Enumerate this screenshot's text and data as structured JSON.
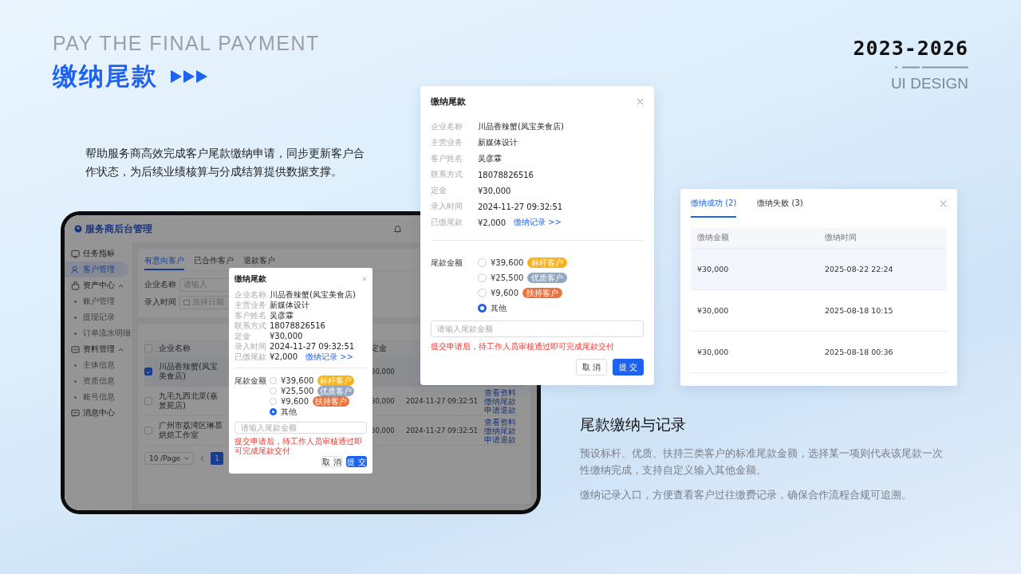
{
  "header": {
    "subtitle": "PAY THE FINAL PAYMENT",
    "title": "缴纳尾款",
    "years": "2023-2026",
    "tag": "UI DESIGN"
  },
  "intro": "帮助服务商高效完成客户尾款缴纳申请，同步更新客户合作状态，为后续业绩核算与分成结算提供数据支撑。",
  "tablet": {
    "brand": "服务商后台管理",
    "sidebar": [
      {
        "label": "任务指标",
        "selected": false
      },
      {
        "label": "客户管理",
        "selected": true
      },
      {
        "label": "资产中心",
        "selected": false,
        "expanded": true,
        "children": [
          {
            "label": "账户管理"
          },
          {
            "label": "提现记录"
          },
          {
            "label": "订单流水明细"
          }
        ]
      },
      {
        "label": "资料管理",
        "selected": false,
        "expanded": true,
        "children": [
          {
            "label": "主体信息"
          },
          {
            "label": "资质信息"
          },
          {
            "label": "账号信息"
          }
        ]
      },
      {
        "label": "消息中心",
        "selected": false
      }
    ],
    "tabs": [
      {
        "label": "有意向客户",
        "selected": true
      },
      {
        "label": "已合作客户",
        "selected": false
      },
      {
        "label": "退款客户",
        "selected": false
      }
    ],
    "filters": [
      {
        "label": "企业名称",
        "placeholder": "请输入",
        "kind": "text"
      },
      {
        "label": "录入时间",
        "placeholder": "选择日期",
        "kind": "date"
      }
    ],
    "table": {
      "all_checked": false,
      "columns": [
        "企业名称",
        "定金"
      ],
      "rows": [
        {
          "checked": true,
          "company": "川品香辣蟹(凤宝美食店)",
          "deposit": "30,000"
        },
        {
          "checked": false,
          "company": "九毛九西北菜(嘉景苑店)",
          "deposit": "30,000",
          "time": "2024-11-27 09:32:51",
          "actions": [
            "查看资料",
            "缴纳尾款",
            "申请退款"
          ]
        },
        {
          "checked": false,
          "company": "广州市荔湾区琳慕烘焙工作室",
          "deposit": "30,000",
          "time": "2024-11-27 09:32:51",
          "actions": [
            "查看资料",
            "缴纳尾款",
            "申请退款"
          ]
        }
      ]
    },
    "pagination": {
      "page_size": "10 /Page",
      "pages": [
        {
          "label": "1",
          "selected": true
        }
      ]
    },
    "modal": {
      "title": "缴纳尾款",
      "fields": [
        {
          "label": "企业名称",
          "value": "川品香辣蟹(凤宝美食店)"
        },
        {
          "label": "主营业务",
          "value": "新媒体设计"
        },
        {
          "label": "客户姓名",
          "value": "吴彦霖"
        },
        {
          "label": "联系方式",
          "value": "18078826516"
        },
        {
          "label": "定金",
          "value": "¥30,000"
        },
        {
          "label": "录入时间",
          "value": "2024-11-27 09:32:51"
        },
        {
          "label": "已缴尾款",
          "value": "¥2,000",
          "link": "缴纳记录 >>"
        }
      ],
      "amount_label": "尾款金额",
      "options": [
        {
          "amount": "¥39,600",
          "tag": "标杆客户",
          "color": "#f7b21f",
          "selected": false
        },
        {
          "amount": "¥25,500",
          "tag": "优质客户",
          "color": "#93a6c0",
          "selected": false
        },
        {
          "amount": "¥9,600",
          "tag": "扶持客户",
          "color": "#ea7440",
          "selected": false
        },
        {
          "amount": "其他",
          "selected": true
        }
      ],
      "input_placeholder": "请输入尾款金额",
      "hint": "提交申请后，待工作人员审核通过即可完成尾款交付",
      "buttons": [
        {
          "label": "取 消",
          "kind": "secondary"
        },
        {
          "label": "提 交",
          "kind": "primary"
        }
      ]
    }
  },
  "modal": {
    "title": "缴纳尾款",
    "fields": [
      {
        "label": "企业名称",
        "value": "川品香辣蟹(凤宝美食店)"
      },
      {
        "label": "主营业务",
        "value": "新媒体设计"
      },
      {
        "label": "客户姓名",
        "value": "吴彦霖"
      },
      {
        "label": "联系方式",
        "value": "18078826516"
      },
      {
        "label": "定金",
        "value": "¥30,000"
      },
      {
        "label": "录入时间",
        "value": "2024-11-27 09:32:51"
      },
      {
        "label": "已缴尾款",
        "value": "¥2,000",
        "link": "缴纳记录 >>"
      }
    ],
    "amount_label": "尾款金额",
    "options": [
      {
        "amount": "¥39,600",
        "tag": "标杆客户",
        "color": "#f7b21f",
        "selected": false
      },
      {
        "amount": "¥25,500",
        "tag": "优质客户",
        "color": "#93a6c0",
        "selected": false
      },
      {
        "amount": "¥9,600",
        "tag": "扶持客户",
        "color": "#ea7440",
        "selected": false
      },
      {
        "amount": "其他",
        "selected": true
      }
    ],
    "input_placeholder": "请输入尾款金额",
    "hint": "提交申请后，待工作人员审核通过即可完成尾款交付",
    "buttons": [
      {
        "label": "取 消",
        "kind": "secondary"
      },
      {
        "label": "提 交",
        "kind": "primary"
      }
    ]
  },
  "history": {
    "tabs": [
      {
        "label": "缴纳成功 (2)",
        "selected": true
      },
      {
        "label": "缴纳失败 (3)",
        "selected": false
      }
    ],
    "columns": [
      "缴纳金额",
      "缴纳时间"
    ],
    "rows": [
      {
        "amount": "¥30,000",
        "time": "2025-08-22 22:24",
        "selected": true
      },
      {
        "amount": "¥30,000",
        "time": "2025-08-18 10:15",
        "selected": false
      },
      {
        "amount": "¥30,000",
        "time": "2025-08-18 00:36",
        "selected": false
      }
    ]
  },
  "feature": {
    "title": "尾款缴纳与记录",
    "paragraphs": [
      "预设标杆、优质、扶持三类客户的标准尾款金额，选择某一项则代表该尾款一次性缴纳完成，支持自定义输入其他金额。",
      "缴纳记录入口，方便查看客户过往缴费记录，确保合作流程合规可追溯。"
    ]
  }
}
